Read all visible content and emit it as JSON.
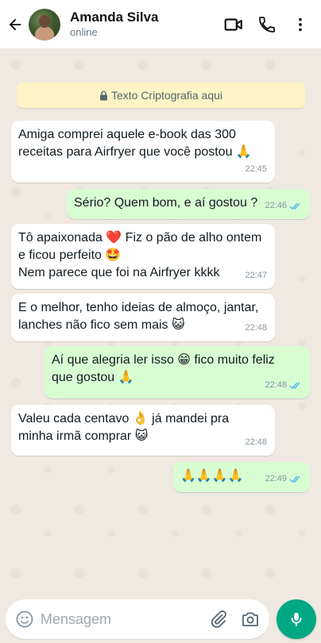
{
  "header": {
    "contact_name": "Amanda Silva",
    "status": "online",
    "icons": [
      "back-arrow-icon",
      "video-call-icon",
      "voice-call-icon",
      "more-options-icon"
    ]
  },
  "chat": {
    "encryption_notice": "Texto Criptografia aqui",
    "messages": [
      {
        "direction": "in",
        "text": "Amiga comprei aquele e-book das 300\nreceitas para Airfryer que você postou 🙏",
        "time": "22:45"
      },
      {
        "direction": "out",
        "text": "Sério? Quem bom, e aí gostou ?",
        "time": "22:46",
        "status": "read"
      },
      {
        "direction": "in",
        "text": "Tô apaixonada ❤️ Fiz o pão de alho ontem\ne ficou perfeito 🤩\nNem parece que foi na Airfryer kkkk",
        "time": "22:47"
      },
      {
        "direction": "in",
        "text": "E o melhor, tenho ideias de almoço, jantar,\nlanches não fico sem mais 😺",
        "time": "22:48"
      },
      {
        "direction": "out",
        "text": "Aí que alegria ler isso 😁 fico muito feliz\nque gostou 🙏",
        "time": "22:48",
        "status": "read"
      },
      {
        "direction": "in",
        "text": "Valeu cada centavo 👌 já mandei pra\nminha irmã comprar 😺",
        "time": "22:48"
      },
      {
        "direction": "out",
        "text": "🙏🙏🙏🙏",
        "time": "22:49",
        "status": "read"
      }
    ]
  },
  "input": {
    "placeholder": "Mensagem",
    "value": ""
  },
  "colors": {
    "accent": "#00a884",
    "outgoing_bubble": "#d9fdd3",
    "incoming_bubble": "#ffffff",
    "read_ticks": "#53bdeb",
    "encryption_bg": "#fdf4c5"
  }
}
